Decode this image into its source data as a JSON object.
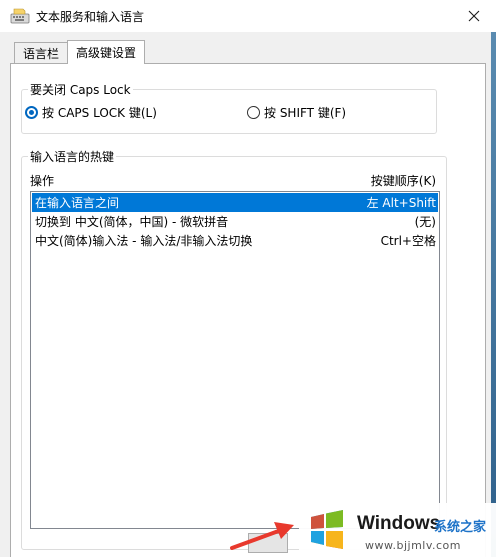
{
  "window": {
    "title": "文本服务和输入语言",
    "close_icon": "close-icon"
  },
  "tabs": [
    {
      "label": "语言栏",
      "active": false
    },
    {
      "label": "高级键设置",
      "active": true
    }
  ],
  "caps_lock_group": {
    "title": "要关闭 Caps Lock",
    "options": [
      {
        "label": "按 CAPS LOCK 键(L)",
        "checked": true
      },
      {
        "label": "按 SHIFT 键(F)",
        "checked": false
      }
    ]
  },
  "hotkeys_group": {
    "title": "输入语言的热键",
    "col_action": "操作",
    "col_sequence": "按键顺序(K)",
    "rows": [
      {
        "action": "在输入语言之间",
        "keys": "左 Alt+Shift",
        "selected": true
      },
      {
        "action": "切换到 中文(简体，中国) - 微软拼音",
        "keys": "(无)",
        "selected": false
      },
      {
        "action": "中文(简体)输入法 - 输入法/非输入法切换",
        "keys": "Ctrl+空格",
        "selected": false
      }
    ]
  },
  "watermark": {
    "brand": "Windows",
    "brand_cn": "系统之家",
    "url": "www.bjjmlv.com"
  },
  "colors": {
    "selection": "#0078d7",
    "radio_accent": "#0067c0",
    "arrow": "#e8392d"
  }
}
